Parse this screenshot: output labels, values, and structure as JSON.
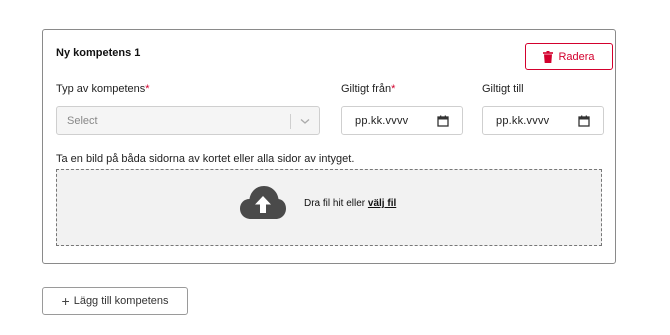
{
  "card": {
    "title": "Ny kompetens 1",
    "delete_label": "Radera",
    "type_label": "Typ av kompetens",
    "valid_from_label": "Giltigt från",
    "valid_to_label": "Giltigt till",
    "required_mark": "*",
    "select_placeholder": "Select",
    "date_placeholder": "pp.kk.vvvv",
    "upload_hint": "Ta en bild på båda sidorna av kortet eller alla sidor av intyget.",
    "drop_text": "Dra fil hit eller ",
    "drop_link": "välj fil"
  },
  "add_button_label": "Lägg till kompetens",
  "colors": {
    "accent": "#d3002d",
    "border": "#8a8a8a",
    "dropzone_bg": "#f2f2f2",
    "cloud_icon": "#4a4a4a"
  },
  "icons": {
    "delete": "trash-icon",
    "select": "chevron-down-icon",
    "date": "calendar-icon",
    "upload": "cloud-upload-icon",
    "add": "plus-icon"
  }
}
